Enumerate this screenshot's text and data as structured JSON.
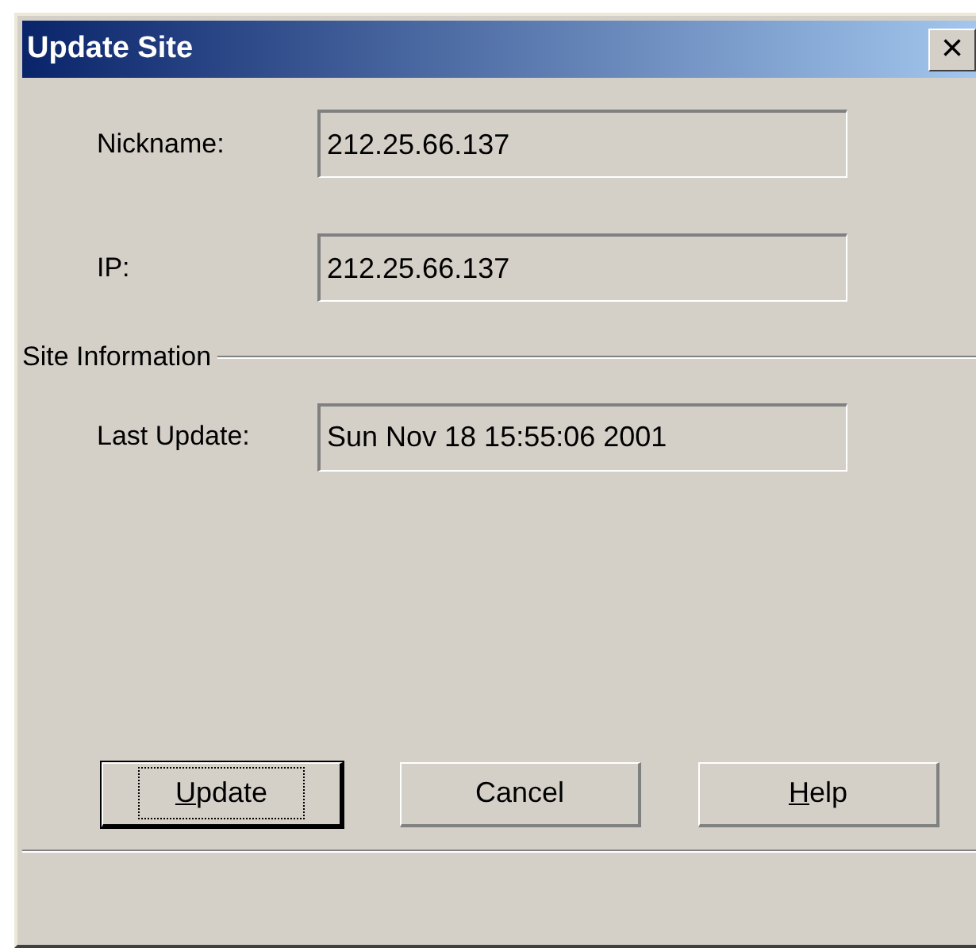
{
  "window": {
    "title": "Update Site",
    "close_glyph": "×"
  },
  "fields": [
    {
      "label": "Nickname:",
      "value": "212.25.66.137"
    },
    {
      "label": "IP:",
      "value": "212.25.66.137"
    }
  ],
  "group": {
    "title": "Site Information",
    "fields": [
      {
        "label": "Last Update:",
        "value": "Sun Nov 18 15:55:06 2001"
      }
    ]
  },
  "buttons": [
    {
      "mnemonic": "U",
      "rest": "pdate",
      "default": true
    },
    {
      "rest": "Cancel",
      "default": false
    },
    {
      "mnemonic": "H",
      "rest": "elp",
      "default": false
    }
  ]
}
